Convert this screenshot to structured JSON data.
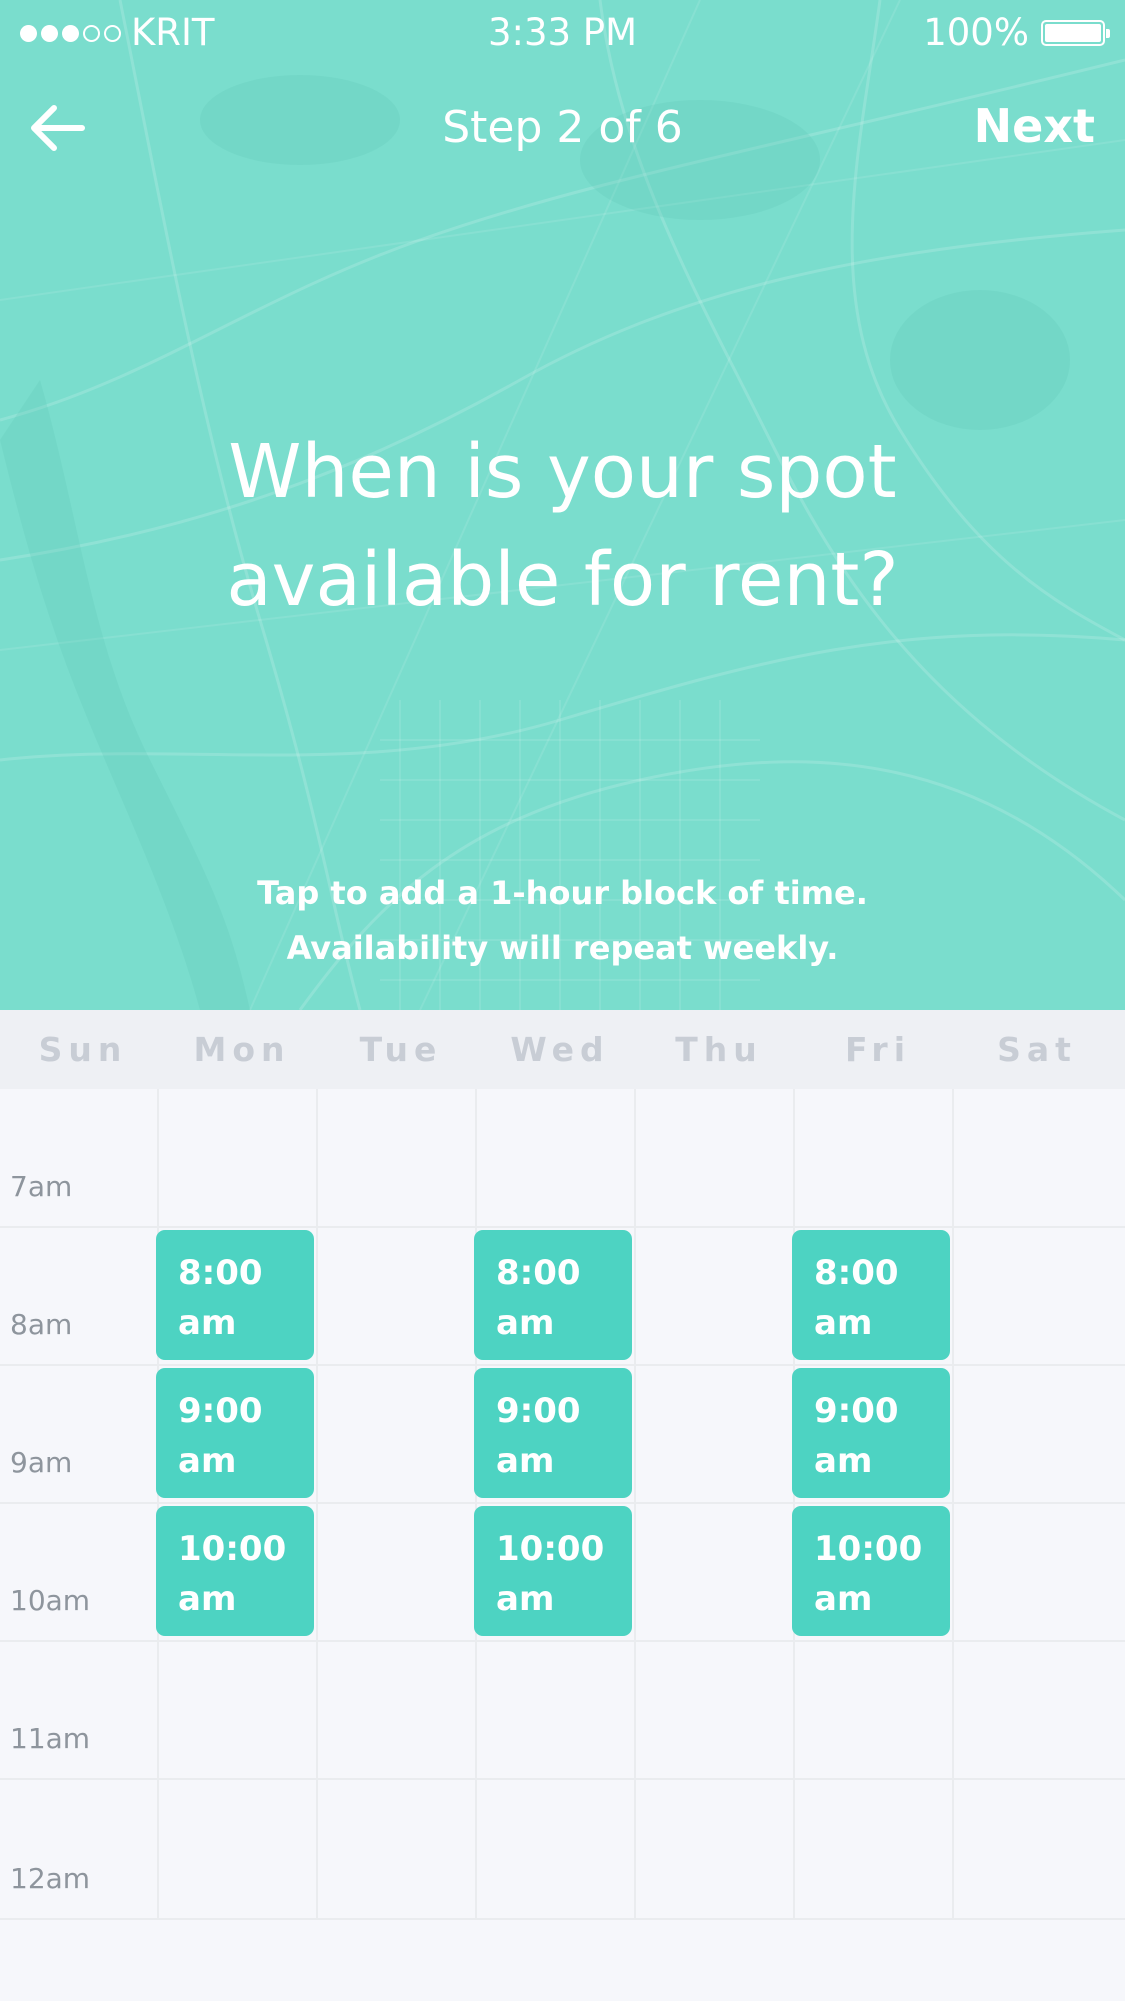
{
  "status_bar": {
    "carrier": "KRIT",
    "signal_bars_filled": 3,
    "signal_bars_total": 5,
    "time": "3:33 PM",
    "battery": "100%"
  },
  "nav": {
    "back_icon": "left-arrow-icon",
    "step_title": "Step 2 of 6",
    "next_label": "Next"
  },
  "headline": {
    "line1": "When is your spot",
    "line2": "available for rent?"
  },
  "instructions": {
    "line1": "Tap to add a 1-hour block of time.",
    "line2": "Availability will repeat weekly."
  },
  "calendar": {
    "days": [
      "Sun",
      "Mon",
      "Tue",
      "Wed",
      "Thu",
      "Fri",
      "Sat"
    ],
    "hours": [
      "7am",
      "8am",
      "9am",
      "10am",
      "11am",
      "12am"
    ],
    "selected_slots": [
      {
        "day": "Mon",
        "hour": "8am",
        "time": "8:00",
        "meridiem": "am"
      },
      {
        "day": "Mon",
        "hour": "9am",
        "time": "9:00",
        "meridiem": "am"
      },
      {
        "day": "Mon",
        "hour": "10am",
        "time": "10:00",
        "meridiem": "am"
      },
      {
        "day": "Wed",
        "hour": "8am",
        "time": "8:00",
        "meridiem": "am"
      },
      {
        "day": "Wed",
        "hour": "9am",
        "time": "9:00",
        "meridiem": "am"
      },
      {
        "day": "Wed",
        "hour": "10am",
        "time": "10:00",
        "meridiem": "am"
      },
      {
        "day": "Fri",
        "hour": "8am",
        "time": "8:00",
        "meridiem": "am"
      },
      {
        "day": "Fri",
        "hour": "9am",
        "time": "9:00",
        "meridiem": "am"
      },
      {
        "day": "Fri",
        "hour": "10am",
        "time": "10:00",
        "meridiem": "am"
      }
    ]
  },
  "colors": {
    "hero_background": "#7addcd",
    "slot_fill": "#4dd3c2",
    "day_header_text": "#c8cdd5",
    "time_label_text": "#8e959d",
    "grid_background": "#f6f7fb"
  }
}
